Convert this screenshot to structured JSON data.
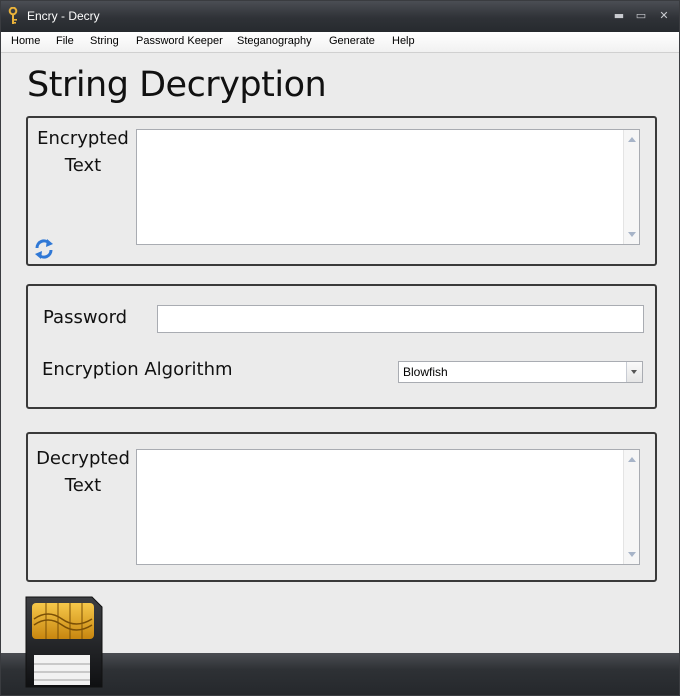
{
  "window": {
    "title": "Encry - Decry",
    "controls": {
      "minimize": "▬",
      "maximize": "▭",
      "close": "✕"
    }
  },
  "menu": [
    "Home",
    "File",
    "String",
    "Password Keeper",
    "Steganography",
    "Generate",
    "Help"
  ],
  "page": {
    "heading": "String Decryption"
  },
  "encrypted": {
    "label_line1": "Encrypted",
    "label_line2": "Text",
    "value": "",
    "swap_icon": "refresh-icon"
  },
  "settings": {
    "password_label": "Password",
    "password_value": "",
    "algorithm_label": "Encryption Algorithm",
    "algorithm_selected": "Blowfish"
  },
  "decrypted": {
    "label_line1": "Decrypted",
    "label_line2": "Text",
    "value": ""
  },
  "footer": {
    "logo": "memory-card-icon"
  },
  "colors": {
    "titlebar": "#2f3237",
    "panel": "#ebebeb",
    "border": "#3a3a3a",
    "icon_blue": "#2f78d6",
    "chip_gold": "#e3a520"
  }
}
